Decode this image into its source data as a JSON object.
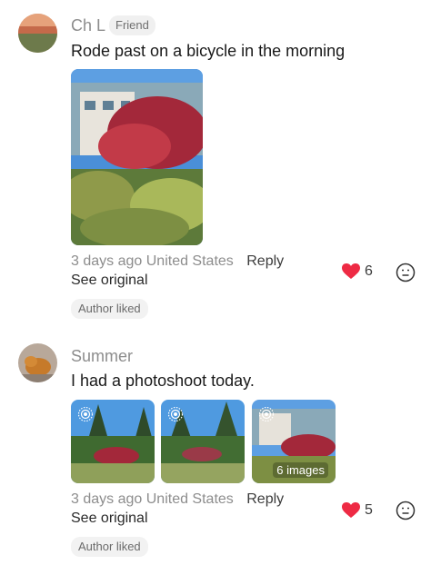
{
  "comments": [
    {
      "author": "Ch L",
      "badge": "Friend",
      "text": "Rode past on a bicycle in the morning",
      "time": "3 days ago",
      "location": "United States",
      "reply_label": "Reply",
      "see_original": "See original",
      "author_liked": "Author liked",
      "like_count": "6"
    },
    {
      "author": "Summer",
      "text": "I had a photoshoot today.",
      "time": "3 days ago",
      "location": "United States",
      "reply_label": "Reply",
      "see_original": "See original",
      "author_liked": "Author liked",
      "like_count": "5",
      "images_overlay": "6 images"
    }
  ],
  "colors": {
    "heart": "#ee2a44",
    "muted": "#8d8d8d",
    "badge_bg": "#f0f0f0"
  },
  "icons": [
    "heart-icon",
    "emoji-reaction-icon",
    "live-photo-icon"
  ]
}
